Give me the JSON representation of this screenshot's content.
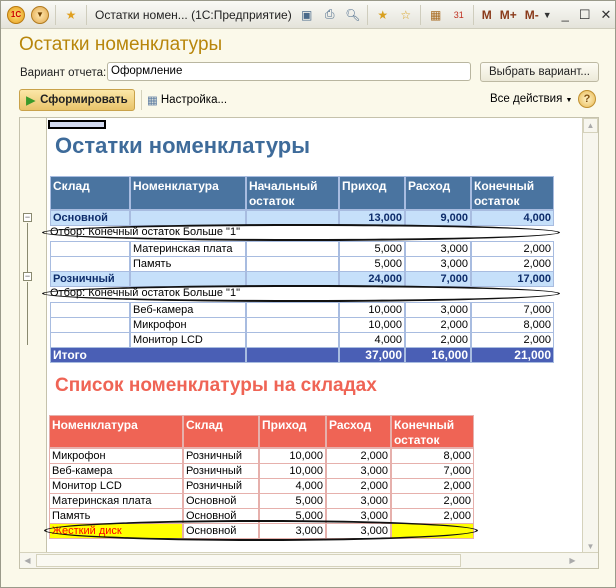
{
  "window": {
    "title": "Остатки номен...  (1С:Предприятие)",
    "toolbar_icons": [
      "save-icon",
      "print-icon",
      "preview-icon",
      "add-favorite-icon",
      "favorite-icon",
      "calculator-icon",
      "calendar-icon"
    ],
    "memory": [
      "M",
      "M+",
      "M-"
    ]
  },
  "form": {
    "title": "Остатки номенклатуры",
    "variant_label": "Вариант отчета:",
    "variant_value": "Оформление",
    "choose_variant": "Выбрать вариант...",
    "generate": "Сформировать",
    "settings": "Настройка...",
    "all_actions": "Все действия",
    "help": "?"
  },
  "report": {
    "title1": "Остатки номенклатуры",
    "table1": {
      "headers": [
        "Склад",
        "Номенклатура",
        "Начальный остаток",
        "Приход",
        "Расход",
        "Конечный остаток"
      ],
      "rows": [
        {
          "type": "group",
          "cells": [
            "Основной",
            "",
            "",
            "13,000",
            "9,000",
            "4,000"
          ]
        },
        {
          "type": "filter",
          "text": "Отбор: Конечный остаток Больше \"1\""
        },
        {
          "type": "item",
          "cells": [
            "",
            "Материнская плата",
            "",
            "5,000",
            "3,000",
            "2,000"
          ]
        },
        {
          "type": "item",
          "cells": [
            "",
            "Память",
            "",
            "5,000",
            "3,000",
            "2,000"
          ]
        },
        {
          "type": "group",
          "cells": [
            "Розничный",
            "",
            "",
            "24,000",
            "7,000",
            "17,000"
          ]
        },
        {
          "type": "filter",
          "text": "Отбор: Конечный остаток Больше \"1\""
        },
        {
          "type": "item",
          "cells": [
            "",
            "Веб-камера",
            "",
            "10,000",
            "3,000",
            "7,000"
          ]
        },
        {
          "type": "item",
          "cells": [
            "",
            "Микрофон",
            "",
            "10,000",
            "2,000",
            "8,000"
          ]
        },
        {
          "type": "item",
          "cells": [
            "",
            "Монитор LCD",
            "",
            "4,000",
            "2,000",
            "2,000"
          ]
        },
        {
          "type": "total",
          "cells": [
            "Итого",
            "",
            "",
            "37,000",
            "16,000",
            "21,000"
          ]
        }
      ]
    },
    "title2": "Список номенклатуры на складах",
    "table2": {
      "headers": [
        "Номенклатура",
        "Склад",
        "Приход",
        "Расход",
        "Конечный остаток"
      ],
      "rows": [
        {
          "cells": [
            "Микрофон",
            "Розничный",
            "10,000",
            "2,000",
            "8,000"
          ]
        },
        {
          "cells": [
            "Веб-камера",
            "Розничный",
            "10,000",
            "3,000",
            "7,000"
          ]
        },
        {
          "cells": [
            "Монитор LCD",
            "Розничный",
            "4,000",
            "2,000",
            "2,000"
          ]
        },
        {
          "cells": [
            "Материнская плата",
            "Основной",
            "5,000",
            "3,000",
            "2,000"
          ]
        },
        {
          "cells": [
            "Память",
            "Основной",
            "5,000",
            "3,000",
            "2,000"
          ]
        },
        {
          "cells": [
            "Жесткий диск",
            "Основной",
            "3,000",
            "3,000",
            ""
          ],
          "highlight": true
        }
      ]
    },
    "colors": {
      "t1_header": "#4a74a0",
      "t1_group": "#c6e0fa",
      "t1_total": "#4a5fb5",
      "t2_header": "#ef6455",
      "highlight": "#ffff00",
      "highlight_text": "#ff0000"
    }
  }
}
